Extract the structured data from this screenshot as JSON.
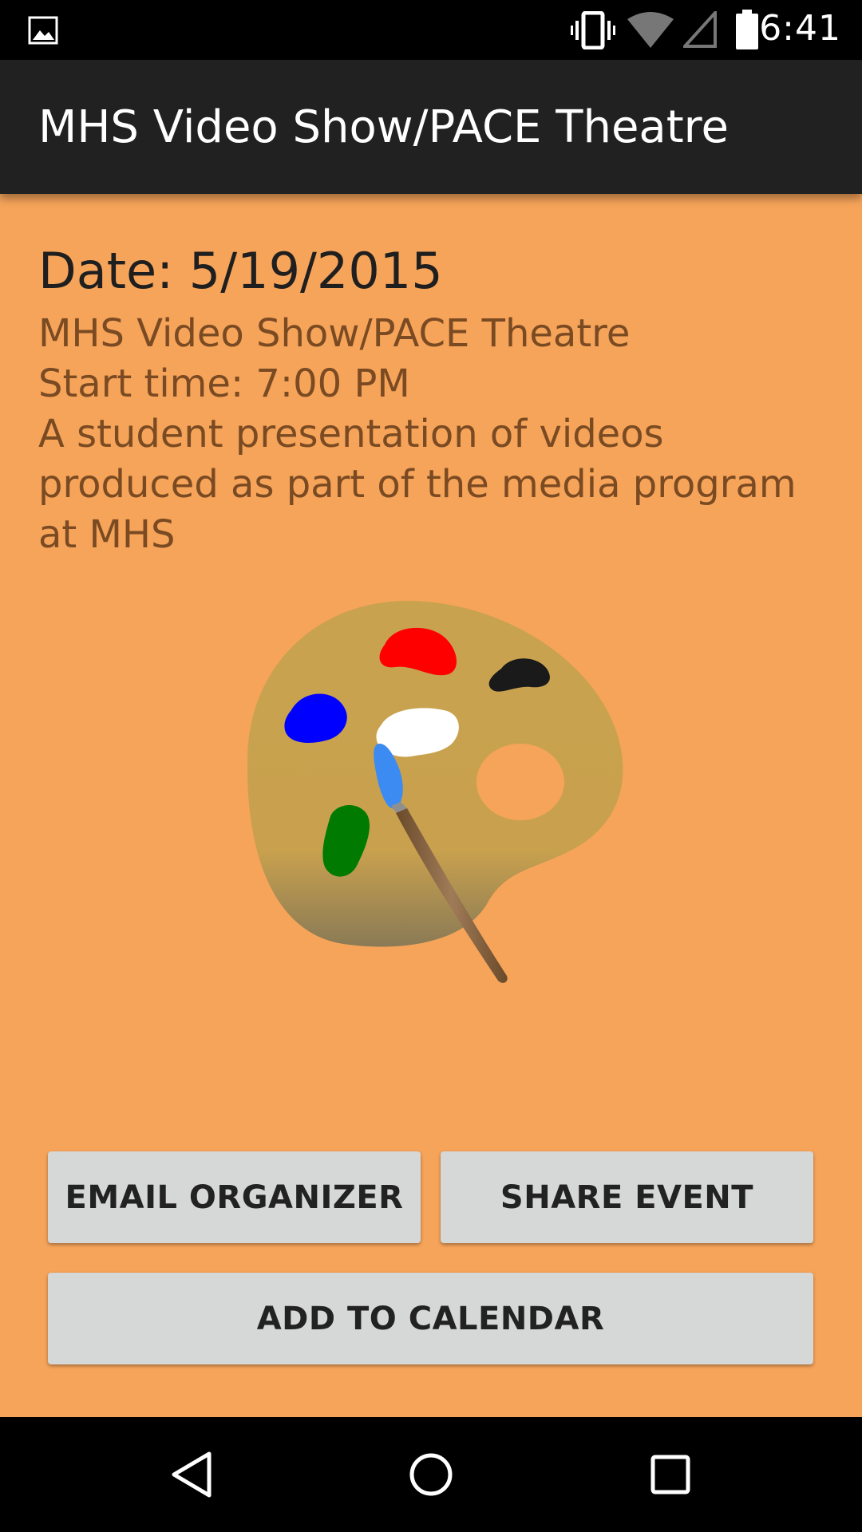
{
  "status_bar": {
    "time": "6:41",
    "icons": [
      "image-notification-icon",
      "vibrate-icon",
      "wifi-icon",
      "signal-icon",
      "battery-icon"
    ]
  },
  "app_bar": {
    "title": "MHS Video Show/PACE Theatre"
  },
  "event": {
    "date_line": "Date: 5/19/2015",
    "title": "MHS Video Show/PACE Theatre",
    "start_time": "Start time: 7:00 PM",
    "description_lines": [
      "A student presentation of videos",
      "produced as part of the media program",
      "at MHS"
    ],
    "image_icon": "paint-palette-icon"
  },
  "buttons": {
    "email_organizer": "EMAIL ORGANIZER",
    "share_event": "SHARE EVENT",
    "add_to_calendar": "ADD TO CALENDAR"
  },
  "nav_bar": {
    "icons": [
      "back-icon",
      "home-icon",
      "recents-icon"
    ]
  },
  "colors": {
    "content_background": "#f6a45a",
    "app_bar": "#212121",
    "description_text": "#7a4a22",
    "button": "#d6d7d7"
  }
}
